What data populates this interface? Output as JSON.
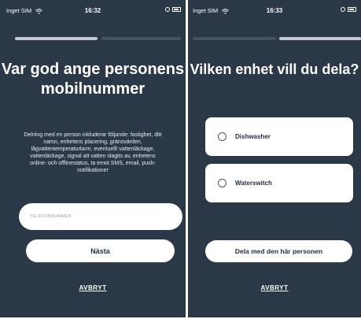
{
  "status_left": {
    "carrier": "Inget SIM",
    "time": "16:32"
  },
  "status_right": {
    "carrier": "Inget SIM",
    "time": "16:33"
  },
  "colors": {
    "background": "#2b3848",
    "progress_active": "#c4cbd3",
    "progress_inactive": "#445363",
    "card": "#ffffff"
  },
  "phone_screen": {
    "title": "Var god ange personens mobilnummer",
    "description": "Delning med en person inkluderar följande: fastighet, ditt namn, enhetens placering, gränsvärden, lågvattentemperaturlarm, eventuellt vattenläckage, vattenläckage, signal att vatten slagits av, enhetens online- och offlinestatus, ta emot SMS, email, push-notifikationer",
    "phone_placeholder": "TELEFONNUMMER",
    "next_label": "Nästa",
    "cancel_label": "AVBRYT"
  },
  "device_screen": {
    "title": "Vilken enhet vill du dela?",
    "devices": [
      {
        "label": "Dishwasher",
        "selected": false
      },
      {
        "label": "Waterswitch",
        "selected": false
      }
    ],
    "share_label": "Dela med den här personen",
    "cancel_label": "AVBRYT"
  }
}
